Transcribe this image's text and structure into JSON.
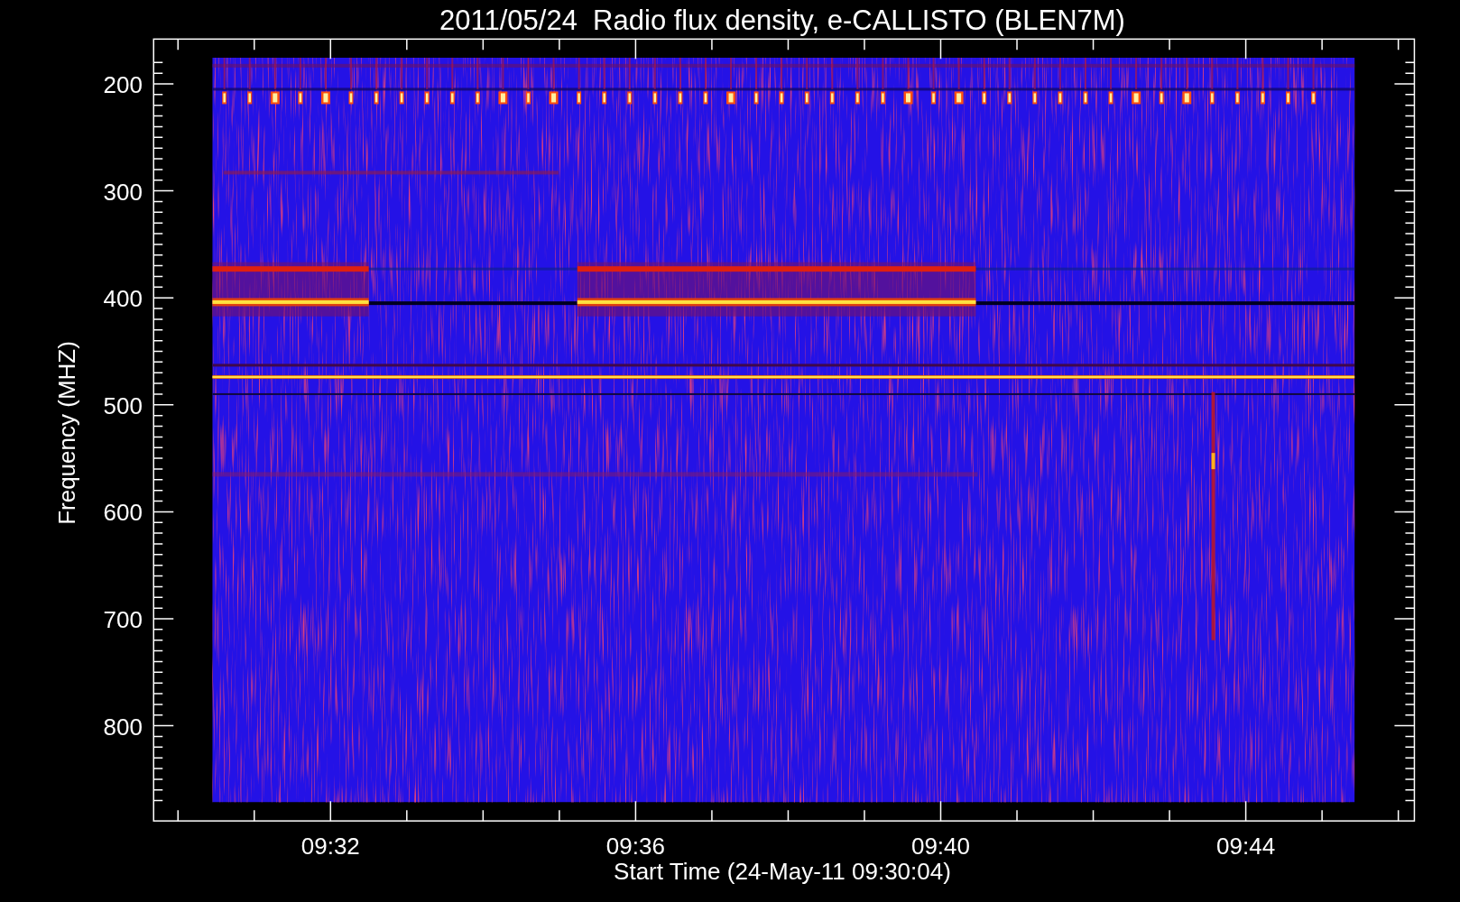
{
  "plot": {
    "title": "2011/05/24  Radio flux density, e-CALLISTO (BLEN7M)",
    "ylabel": "Frequency (MHZ)",
    "xlabel": "Start Time (24-May-11 09:30:04)",
    "y_ticks": [
      "200",
      "300",
      "400",
      "500",
      "600",
      "700",
      "800"
    ],
    "x_ticks": [
      "09:32",
      "09:36",
      "09:40",
      "09:44"
    ]
  }
}
